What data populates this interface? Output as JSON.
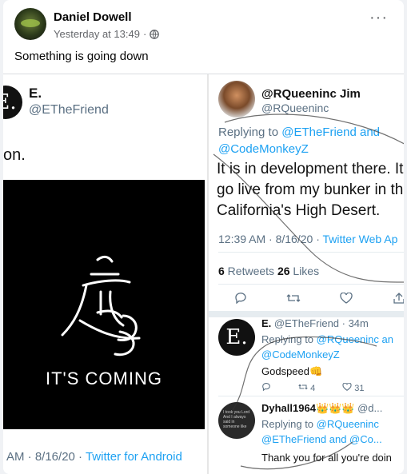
{
  "post": {
    "author": "Daniel Dowell",
    "timestamp": "Yesterday at 13:49",
    "separator": "·",
    "privacy_icon": "globe-icon",
    "more_icon": "more-options-icon",
    "more_label": "···",
    "text": "Something is going down"
  },
  "left_tweet": {
    "avatar_letter": "E.",
    "name": "E.",
    "handle": "@ETheFriend",
    "body": "on.",
    "image_caption": "IT'S COMING",
    "time_prefix": "AM · 8/16/20 · ",
    "source": "Twitter for Android"
  },
  "right_tweet": {
    "name": "@RQueeninc Jim",
    "handle": "@RQueeninc",
    "replying_prefix": "Replying to ",
    "reply_to_1": "@ETheFriend and",
    "reply_to_2": "@CodeMonkeyZ",
    "body_line_1": "It is in development there. It w",
    "body_line_2": "go live from my bunker in the",
    "body_line_3": "California's High Desert.",
    "time": "12:39 AM · 8/16/20 · ",
    "source": "Twitter Web Ap",
    "retweets_count": "6",
    "retweets_label": " Retweets ",
    "likes_count": "26",
    "likes_label": " Likes"
  },
  "reply_1": {
    "avatar_letter": "E.",
    "name": "E.",
    "handle_time": " @ETheFriend · 34m",
    "replying_prefix": "Replying to ",
    "reply_to_1": "@RQueeninc an",
    "reply_to_2": "@CodeMonkeyZ",
    "body": "Godspeed👊",
    "retweets": "4",
    "likes": "31"
  },
  "reply_2": {
    "avatar_text": "I took you Lord And I always said in someone like",
    "name": "Dyhall1964",
    "emojis": "👑👑👑",
    "handle_time": " @d...",
    "replying_prefix": "Replying to ",
    "reply_to_1": "@RQueeninc",
    "reply_to_2": "@ETheFriend and @Co...",
    "body": "Thank you for all you're doin"
  },
  "colors": {
    "link": "#1da1f2",
    "muted": "#5b7083",
    "facebook_meta": "#65676b"
  }
}
